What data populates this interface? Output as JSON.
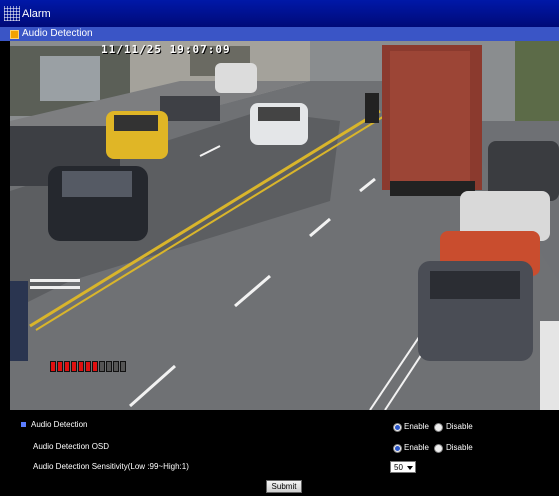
{
  "window": {
    "title": "Alarm"
  },
  "section": {
    "title": "Audio Detection"
  },
  "video": {
    "osd_timestamp": "11/11/25  19:07:09",
    "audio_level": {
      "active_segments": 7,
      "total_segments": 11,
      "active_color": "#e01010",
      "inactive_color": "#555555"
    }
  },
  "settings": {
    "header": "Audio Detection",
    "enable_label": "Enable",
    "disable_label": "Disable",
    "audio_detection": {
      "value": "Enable"
    },
    "osd": {
      "label": "Audio Detection OSD",
      "value": "Enable"
    },
    "sensitivity": {
      "label": "Audio Detection Sensitivity(Low :99~High:1)",
      "value": "50"
    },
    "submit_label": "Submit"
  },
  "colors": {
    "titlebar": "#0018a8",
    "sectionbar": "#3a55c6",
    "accent": "#f2a200"
  }
}
